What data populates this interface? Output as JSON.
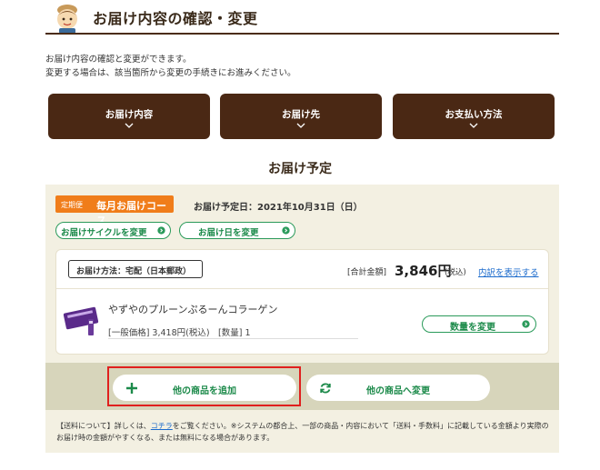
{
  "header": {
    "title": "お届け内容の確認・変更"
  },
  "intro": {
    "line1": "お届け内容の確認と変更ができます。",
    "line2": "変更する場合は、該当箇所から変更の手続きにお進みください。"
  },
  "nav_tabs": [
    {
      "label": "お届け内容"
    },
    {
      "label": "お届け先"
    },
    {
      "label": "お支払い方法"
    }
  ],
  "section": {
    "title": "お届け予定"
  },
  "course": {
    "badge_small": "定期便",
    "badge_big": "毎月お届けコース",
    "delivery_date": "お届け予定日：2021年10月31日（日）",
    "cycle_button": "お届けサイクルを変更",
    "date_button": "お届け日を変更"
  },
  "order": {
    "method": "お届け方法：宅配（日本郵政）",
    "total_label": "[合計金額]",
    "total_value": "3,846円",
    "total_tax": "(税込)",
    "detail_link": "内訳を表示する",
    "product_name": "やずやのプルーンぷるーんコラーゲン",
    "product_meta": "[一般価格] 3,418円(税込)　[数量] 1",
    "qty_button": "数量を変更"
  },
  "actions": {
    "add_label": "他の商品を追加",
    "change_label": "他の商品へ変更"
  },
  "footnote": {
    "pre": "【送料について】詳しくは、",
    "link": "コチラ",
    "post": "をご覧ください。※システムの都合上、一部の商品・内容において「送料・手数料」に記載している金額より実際のお届け時の金額がやすくなる、または無料になる場合があります。"
  },
  "colors": {
    "brand_brown": "#4a2814",
    "accent_orange": "#f07d1a",
    "green": "#1c8a4a",
    "highlight_red": "#e0201e"
  },
  "icons": {
    "mascot": "mascot-icon",
    "chevron": "chevron-down-icon",
    "arrow": "arrow-right-circle-icon",
    "plus": "plus-icon",
    "refresh": "refresh-icon"
  }
}
